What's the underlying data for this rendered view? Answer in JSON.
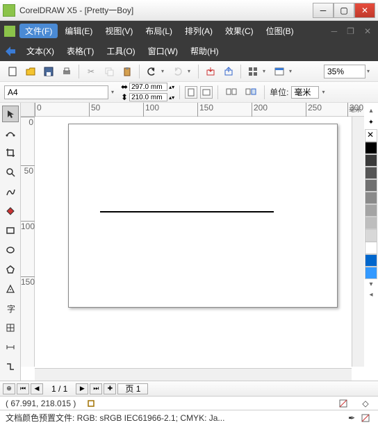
{
  "title": "CorelDRAW X5 - [Pretty一Boy]",
  "menus1": {
    "file": "文件(F)",
    "edit": "编辑(E)",
    "view": "视图(V)",
    "layout": "布局(L)",
    "arrange": "排列(A)",
    "effects": "效果(C)",
    "bitmaps": "位图(B)"
  },
  "menus2": {
    "text": "文本(X)",
    "table": "表格(T)",
    "tools": "工具(O)",
    "window": "窗口(W)",
    "help": "帮助(H)"
  },
  "zoom": "35%",
  "paper": {
    "size": "A4",
    "width": "297.0 mm",
    "height": "210.0 mm"
  },
  "units": {
    "label": "单位:",
    "value": "毫米"
  },
  "ruler_h": [
    {
      "p": 0,
      "v": "0"
    },
    {
      "p": 78,
      "v": "50"
    },
    {
      "p": 156,
      "v": "100"
    },
    {
      "p": 234,
      "v": "150"
    },
    {
      "p": 312,
      "v": "200"
    },
    {
      "p": 390,
      "v": "250"
    },
    {
      "p": 450,
      "v": "300"
    }
  ],
  "ruler_unit": "毫米",
  "ruler_v": [
    {
      "p": 0,
      "v": "0"
    },
    {
      "p": 70,
      "v": "50"
    },
    {
      "p": 150,
      "v": "100"
    },
    {
      "p": 230,
      "v": "150"
    }
  ],
  "swatches": [
    "#000000",
    "#3a3a3a",
    "#555555",
    "#707070",
    "#8a8a8a",
    "#a4a4a4",
    "#bebebe",
    "#d8d8d8",
    "#ffffff",
    "#0066cc",
    "#3399ff"
  ],
  "nav": {
    "pages": "1 / 1",
    "page_tab": "页 1"
  },
  "status": {
    "coords": "( 67.991, 218.015 )",
    "color_profile": "文档颜色预置文件: RGB: sRGB IEC61966-2.1; CMYK: Ja..."
  }
}
